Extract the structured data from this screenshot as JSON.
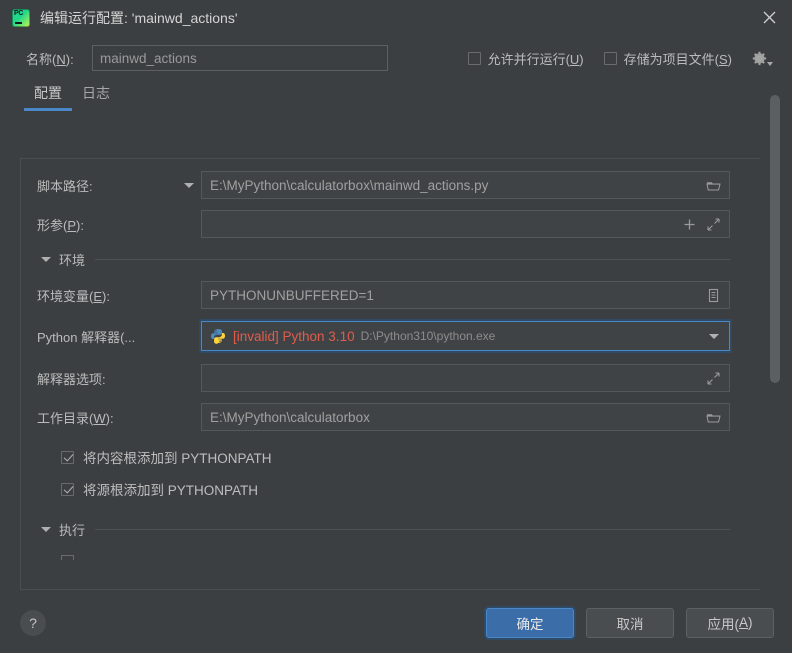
{
  "window": {
    "title": "编辑运行配置: 'mainwd_actions'",
    "app_icon": "pycharm-icon",
    "close_icon": "close-icon"
  },
  "name_row": {
    "label": "名称(N):",
    "value": "mainwd_actions",
    "parallel_checkbox": {
      "label": "允许并行运行(U)",
      "checked": false
    },
    "project_file_checkbox": {
      "label": "存储为项目文件(S)",
      "checked": false
    },
    "gear_icon": "gear-icon"
  },
  "tabs": [
    {
      "label": "配置",
      "active": true
    },
    {
      "label": "日志",
      "active": false
    }
  ],
  "form": {
    "script_path": {
      "label": "脚本路径:",
      "value": "E:\\MyPython\\calculatorbox\\mainwd_actions.py",
      "browse_icon": "folder-icon",
      "dropdown_icon": "chevron-down-icon"
    },
    "parameters": {
      "label": "形参(P):",
      "value": "",
      "add_icon": "plus-icon",
      "expand_icon": "expand-icon"
    },
    "environment_section": {
      "label": "环境",
      "collapsed": false
    },
    "env_variables": {
      "label": "环境变量(E):",
      "value": "PYTHONUNBUFFERED=1",
      "browse_icon": "list-edit-icon"
    },
    "interpreter": {
      "label": "Python 解释器(...",
      "status": "[invalid] Python 3.10",
      "path": "D:\\Python310\\python.exe",
      "python_icon": "python-icon",
      "dropdown_icon": "chevron-down-icon",
      "invalid_color": "#e05c4b",
      "focus_color": "#4a88c7"
    },
    "interpreter_options": {
      "label": "解释器选项:",
      "value": "",
      "expand_icon": "expand-icon"
    },
    "working_directory": {
      "label": "工作目录(W):",
      "value": "E:\\MyPython\\calculatorbox",
      "browse_icon": "folder-icon"
    },
    "add_content_roots": {
      "label": "将内容根添加到 PYTHONPATH",
      "checked": true
    },
    "add_source_roots": {
      "label": "将源根添加到 PYTHONPATH",
      "checked": true
    },
    "execution_section": {
      "label": "执行",
      "collapsed": false
    }
  },
  "footer": {
    "help_label": "?",
    "ok_label": "确定",
    "cancel_label": "取消",
    "apply_label": "应用(A)"
  }
}
